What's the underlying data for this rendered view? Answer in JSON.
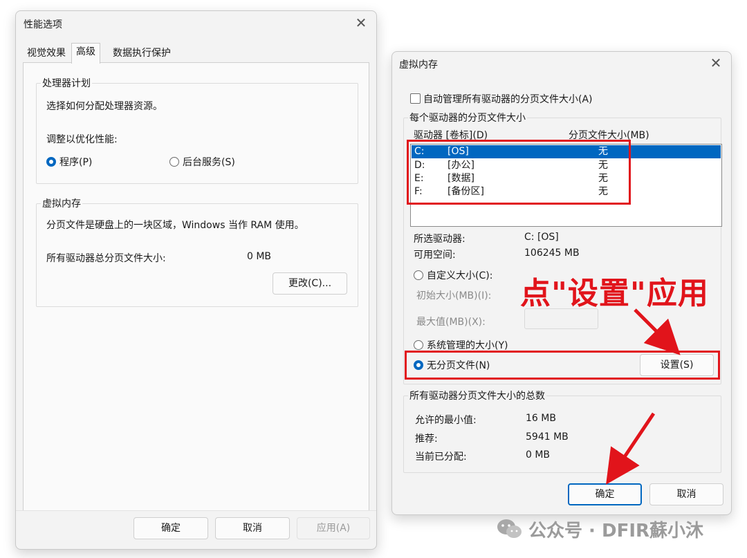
{
  "perf_window": {
    "title": "性能选项",
    "tabs": [
      "视觉效果",
      "高级",
      "数据执行保护"
    ],
    "processor_group": {
      "label": "处理器计划",
      "desc": "选择如何分配处理器资源。",
      "adjust_label": "调整以优化性能:",
      "option_programs": "程序(P)",
      "option_background": "后台服务(S)"
    },
    "vm_group": {
      "label": "虚拟内存",
      "desc": "分页文件是硬盘上的一块区域，Windows 当作 RAM 使用。",
      "total_label": "所有驱动器总分页文件大小:",
      "total_value": "0 MB",
      "change_button": "更改(C)..."
    },
    "buttons": {
      "ok": "确定",
      "cancel": "取消",
      "apply": "应用(A)"
    }
  },
  "vm_window": {
    "title": "虚拟内存",
    "auto_manage": "自动管理所有驱动器的分页文件大小(A)",
    "per_drive_label": "每个驱动器的分页文件大小",
    "col_drive": "驱动器 [卷标](D)",
    "col_size": "分页文件大小(MB)",
    "drives": [
      {
        "letter": "C:",
        "label": "[OS]",
        "size": "无"
      },
      {
        "letter": "D:",
        "label": "[办公]",
        "size": "无"
      },
      {
        "letter": "E:",
        "label": "[数据]",
        "size": "无"
      },
      {
        "letter": "F:",
        "label": "[备份区]",
        "size": "无"
      }
    ],
    "selected_drive_label": "所选驱动器:",
    "selected_drive_value": "C:  [OS]",
    "free_space_label": "可用空间:",
    "free_space_value": "106245 MB",
    "custom_size": "自定义大小(C):",
    "initial_size": "初始大小(MB)(I):",
    "max_size": "最大值(MB)(X):",
    "system_managed": "系统管理的大小(Y)",
    "no_paging": "无分页文件(N)",
    "set_button": "设置(S)",
    "total_group_label": "所有驱动器分页文件大小的总数",
    "min_allowed_label": "允许的最小值:",
    "min_allowed_value": "16 MB",
    "recommended_label": "推荐:",
    "recommended_value": "5941 MB",
    "current_label": "当前已分配:",
    "current_value": "0 MB",
    "ok": "确定",
    "cancel": "取消"
  },
  "annotation": {
    "text": "点\"设置\"应用",
    "color": "#e1141b"
  },
  "watermark": "公众号 · DFIR蘇小沐",
  "colors": {
    "accent": "#0067c0",
    "annotation": "#e1141b"
  }
}
